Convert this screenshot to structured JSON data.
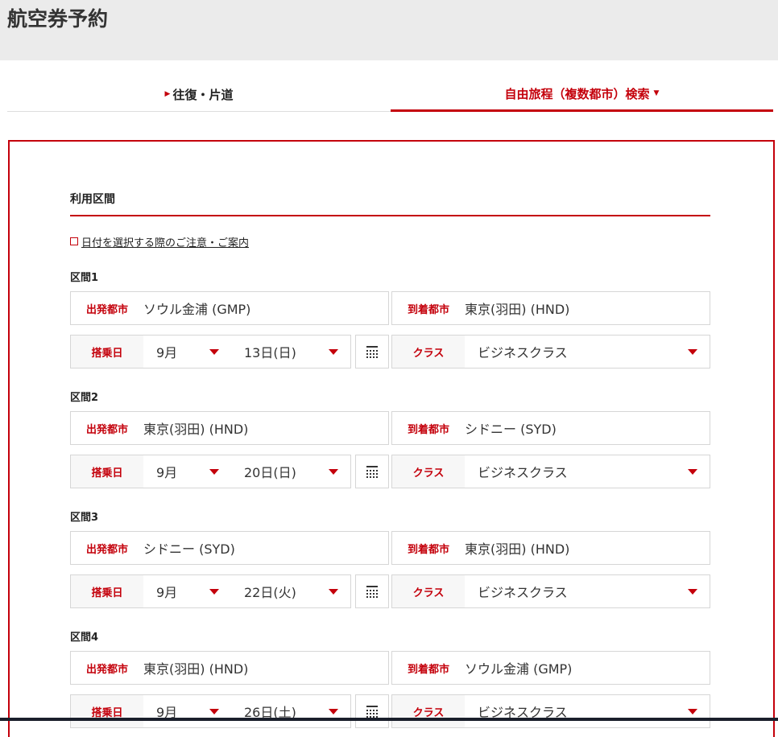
{
  "header": {
    "title": "航空券予約"
  },
  "tabs": [
    {
      "label": "往復・片道"
    },
    {
      "label": "自由旅程（複数都市）検索"
    }
  ],
  "section": {
    "title": "利用区間",
    "notice_link": "日付を選択する際のご注意・ご案内"
  },
  "labels": {
    "departure": "出発都市",
    "arrival": "到着都市",
    "date": "搭乗日",
    "class": "クラス"
  },
  "segments": [
    {
      "name": "区間1",
      "from": "ソウル金浦 (GMP)",
      "to": "東京(羽田) (HND)",
      "month": "9月",
      "day": "13日(日)",
      "class": "ビジネスクラス"
    },
    {
      "name": "区間2",
      "from": "東京(羽田) (HND)",
      "to": "シドニー (SYD)",
      "month": "9月",
      "day": "20日(日)",
      "class": "ビジネスクラス"
    },
    {
      "name": "区間3",
      "from": "シドニー (SYD)",
      "to": "東京(羽田) (HND)",
      "month": "9月",
      "day": "22日(火)",
      "class": "ビジネスクラス"
    },
    {
      "name": "区間4",
      "from": "東京(羽田) (HND)",
      "to": "ソウル金浦 (GMP)",
      "month": "9月",
      "day": "26日(土)",
      "class": "ビジネスクラス"
    }
  ],
  "colors": {
    "accent": "#c4000b"
  }
}
